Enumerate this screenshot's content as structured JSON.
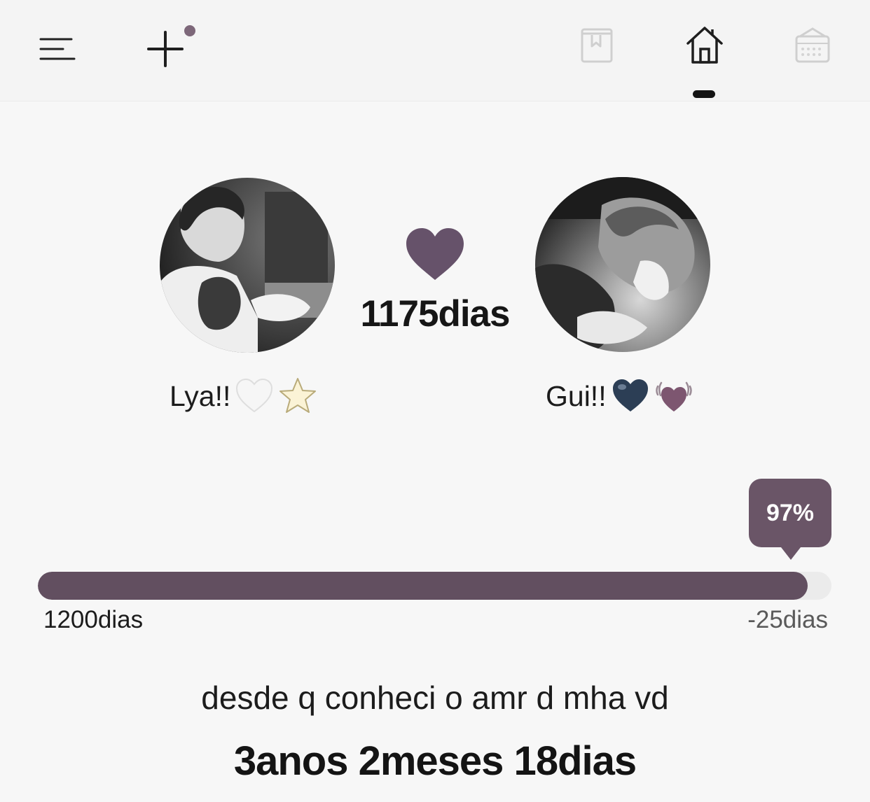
{
  "header": {
    "icons": [
      "menu-icon",
      "add-icon",
      "book-icon",
      "home-icon",
      "calendar-icon"
    ],
    "active_tab": "home",
    "add_badge_color": "#7d6779"
  },
  "couple": {
    "days_together": "1175dias",
    "heart_color": "#66526a",
    "left_person": {
      "name": "Lya!!",
      "emojis": [
        "white-heart",
        "star"
      ]
    },
    "right_person": {
      "name": "Gui!!",
      "emojis": [
        "blue-heart",
        "beating-heart"
      ]
    }
  },
  "progress": {
    "percent_label": "97%",
    "percent_value": 97,
    "start_label": "1200dias",
    "remaining_label": "-25dias",
    "bar_color": "#624f60"
  },
  "footer": {
    "caption": "desde q conheci o amr d mha vd",
    "duration": "3anos 2meses 18dias"
  }
}
